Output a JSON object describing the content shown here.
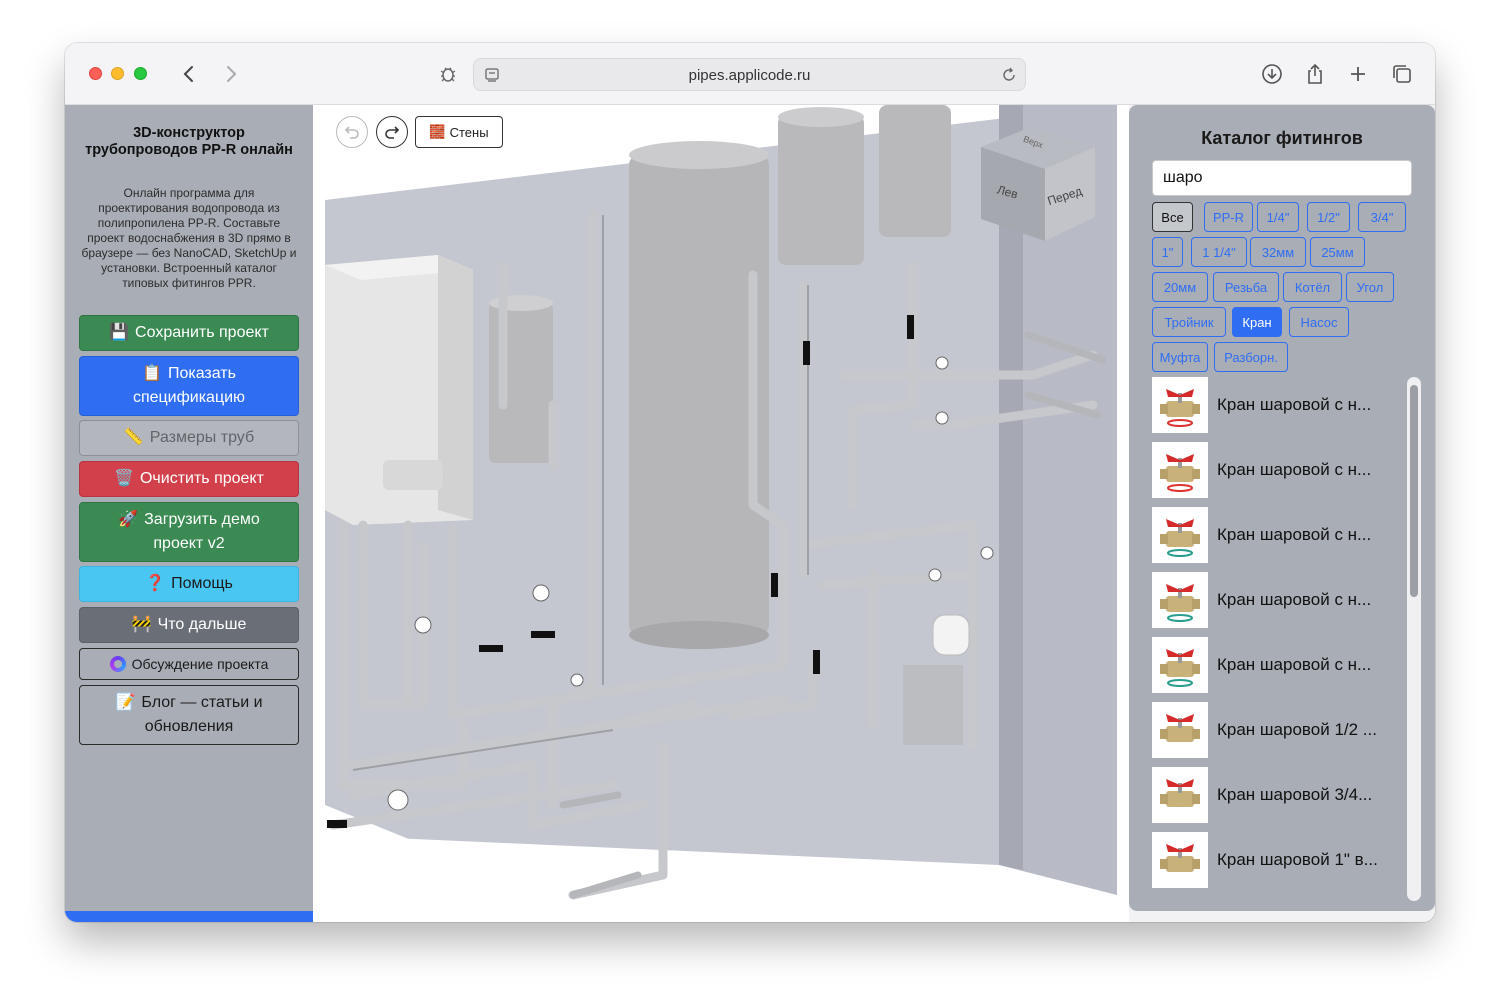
{
  "browser": {
    "url": "pipes.applicode.ru"
  },
  "sidebar": {
    "title": "3D-конструктор трубопроводов PP-R онлайн",
    "description": "Онлайн программа для проектирования водопровода из полипропилена PP-R. Составьте проект водоснабжения в 3D прямо в браузере — без NanoCAD, SketchUp и установки. Встроенный каталог типовых фитингов PPR.",
    "buttons": {
      "save": {
        "label": "Сохранить проект",
        "icon": "💾"
      },
      "spec_line1": "Показать",
      "spec_line2": "спецификацию",
      "spec_icon": "📋",
      "sizes": {
        "label": "Размеры труб",
        "icon": "📏"
      },
      "clear": {
        "label": "Очистить проект",
        "icon": "🗑️"
      },
      "demo_line1": "Загрузить демо",
      "demo_line2": "проект v2",
      "demo_icon": "🚀",
      "help": {
        "label": "Помощь",
        "icon": "❓"
      },
      "next": {
        "label": "Что дальше",
        "icon": "🚧"
      },
      "discuss": {
        "label": "Обсуждение проекта"
      },
      "blog_line1": "Блог — статьи и",
      "blog_line2": "обновления",
      "blog_icon": "📝"
    }
  },
  "viewport": {
    "walls_button": "Стены",
    "walls_icon": "🧱",
    "cube": {
      "top": "Верх",
      "left": "Лев",
      "front": "Перед"
    }
  },
  "catalog": {
    "title": "Каталог фитингов",
    "search_value": "шаро",
    "filters": [
      "Все",
      "PP-R",
      "1/4\"",
      "1/2\"",
      "3/4\"",
      "1\"",
      "1 1/4\"",
      "32мм",
      "25мм",
      "20мм",
      "Резьба",
      "Котёл",
      "Угол",
      "Тройник",
      "Кран",
      "Насос",
      "Муфта",
      "Разборн."
    ],
    "active_filter": "Кран",
    "items": [
      {
        "label": "Кран шаровой с н...",
        "ring": "red"
      },
      {
        "label": "Кран шаровой с н...",
        "ring": "red"
      },
      {
        "label": "Кран шаровой с н...",
        "ring": "teal"
      },
      {
        "label": "Кран шаровой с н...",
        "ring": "teal"
      },
      {
        "label": "Кран шаровой с н...",
        "ring": "teal"
      },
      {
        "label": "Кран шаровой 1/2 ...",
        "ring": "none"
      },
      {
        "label": "Кран шаровой 3/4...",
        "ring": "none"
      },
      {
        "label": "Кран шаровой 1\" в...",
        "ring": "none"
      }
    ]
  },
  "colors": {
    "sidebar_bg": "#a9aeb6",
    "primary": "#2f6df3",
    "success": "#3b8a53",
    "danger": "#d1404b",
    "info": "#49c6f2",
    "dark": "#6a6f77"
  }
}
